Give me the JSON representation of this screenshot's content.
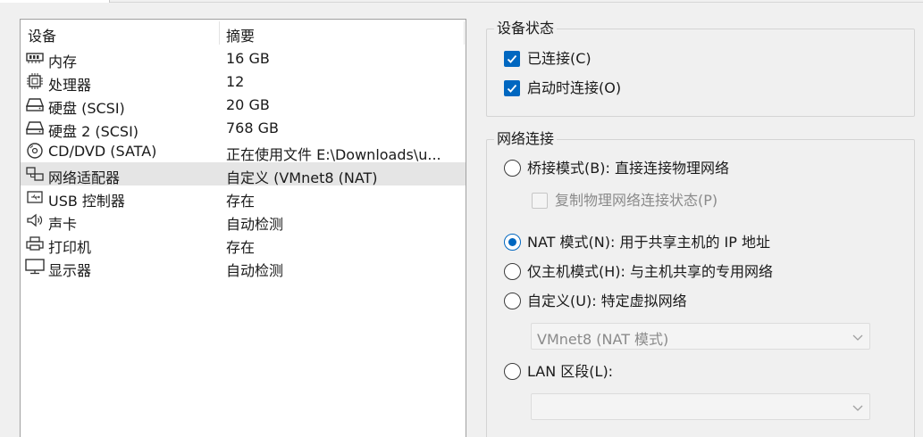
{
  "devices": {
    "header": {
      "device": "设备",
      "summary": "摘要"
    },
    "rows": [
      {
        "name": "内存",
        "summary": "16 GB",
        "icon": "memory-icon"
      },
      {
        "name": "处理器",
        "summary": "12",
        "icon": "processor-icon"
      },
      {
        "name": "硬盘 (SCSI)",
        "summary": "20 GB",
        "icon": "hard-disk-icon"
      },
      {
        "name": "硬盘 2 (SCSI)",
        "summary": "768 GB",
        "icon": "hard-disk-icon"
      },
      {
        "name": "CD/DVD (SATA)",
        "summary": "正在使用文件 E:\\Downloads\\u...",
        "icon": "cd-dvd-icon"
      },
      {
        "name": "网络适配器",
        "summary": "自定义 (VMnet8 (NAT)",
        "icon": "network-adapter-icon",
        "selected": true
      },
      {
        "name": "USB 控制器",
        "summary": "存在",
        "icon": "usb-icon"
      },
      {
        "name": "声卡",
        "summary": "自动检测",
        "icon": "speaker-icon"
      },
      {
        "name": "打印机",
        "summary": "存在",
        "icon": "printer-icon"
      },
      {
        "name": "显示器",
        "summary": "自动检测",
        "icon": "monitor-icon"
      }
    ]
  },
  "device_status": {
    "title": "设备状态",
    "connected": {
      "label": "已连接(C)",
      "checked": true
    },
    "connect_at_power_on": {
      "label": "启动时连接(O)",
      "checked": true
    }
  },
  "network": {
    "title": "网络连接",
    "bridged": {
      "label": "桥接模式(B): 直接连接物理网络",
      "selected": false
    },
    "replicate": {
      "label": "复制物理网络连接状态(P)",
      "checked": false,
      "enabled": false
    },
    "nat": {
      "label": "NAT 模式(N): 用于共享主机的 IP 地址",
      "selected": true
    },
    "host_only": {
      "label": "仅主机模式(H): 与主机共享的专用网络",
      "selected": false
    },
    "custom": {
      "label": "自定义(U): 特定虚拟网络",
      "selected": false
    },
    "custom_select": {
      "value": "VMnet8 (NAT 模式)",
      "enabled": false
    },
    "lan_segment": {
      "label": "LAN 区段(L):",
      "selected": false
    },
    "lan_select": {
      "value": "",
      "enabled": false
    }
  },
  "colors": {
    "accent": "#0067c0",
    "selected_row": "#e5e5e5",
    "panel_bg": "#f0f0f0",
    "disabled_text": "#8a8a8a"
  }
}
